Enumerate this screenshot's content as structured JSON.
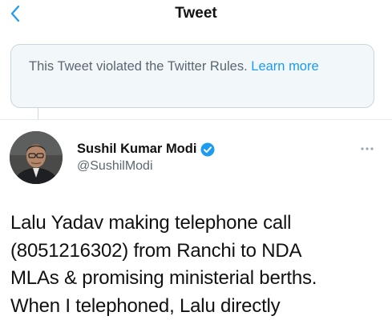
{
  "header": {
    "title": "Tweet",
    "back_icon": "chevron-left-icon"
  },
  "notice": {
    "text": "This Tweet violated the Twitter Rules.",
    "link": "Learn more"
  },
  "tweet": {
    "author_name": "Sushil Kumar Modi",
    "verified_icon": "verified-badge-icon",
    "handle": "@SushilModi",
    "more_icon": "more-dots-icon",
    "lines": [
      "Lalu Yadav making telephone call",
      "(8051216302) from Ranchi to NDA",
      "MLAs & promising ministerial berths.",
      "When I telephoned, Lalu directly"
    ]
  },
  "colors": {
    "accent": "#1d9bf0",
    "notice_bg": "#f2f7fa",
    "secondary_text": "#5b6770"
  }
}
